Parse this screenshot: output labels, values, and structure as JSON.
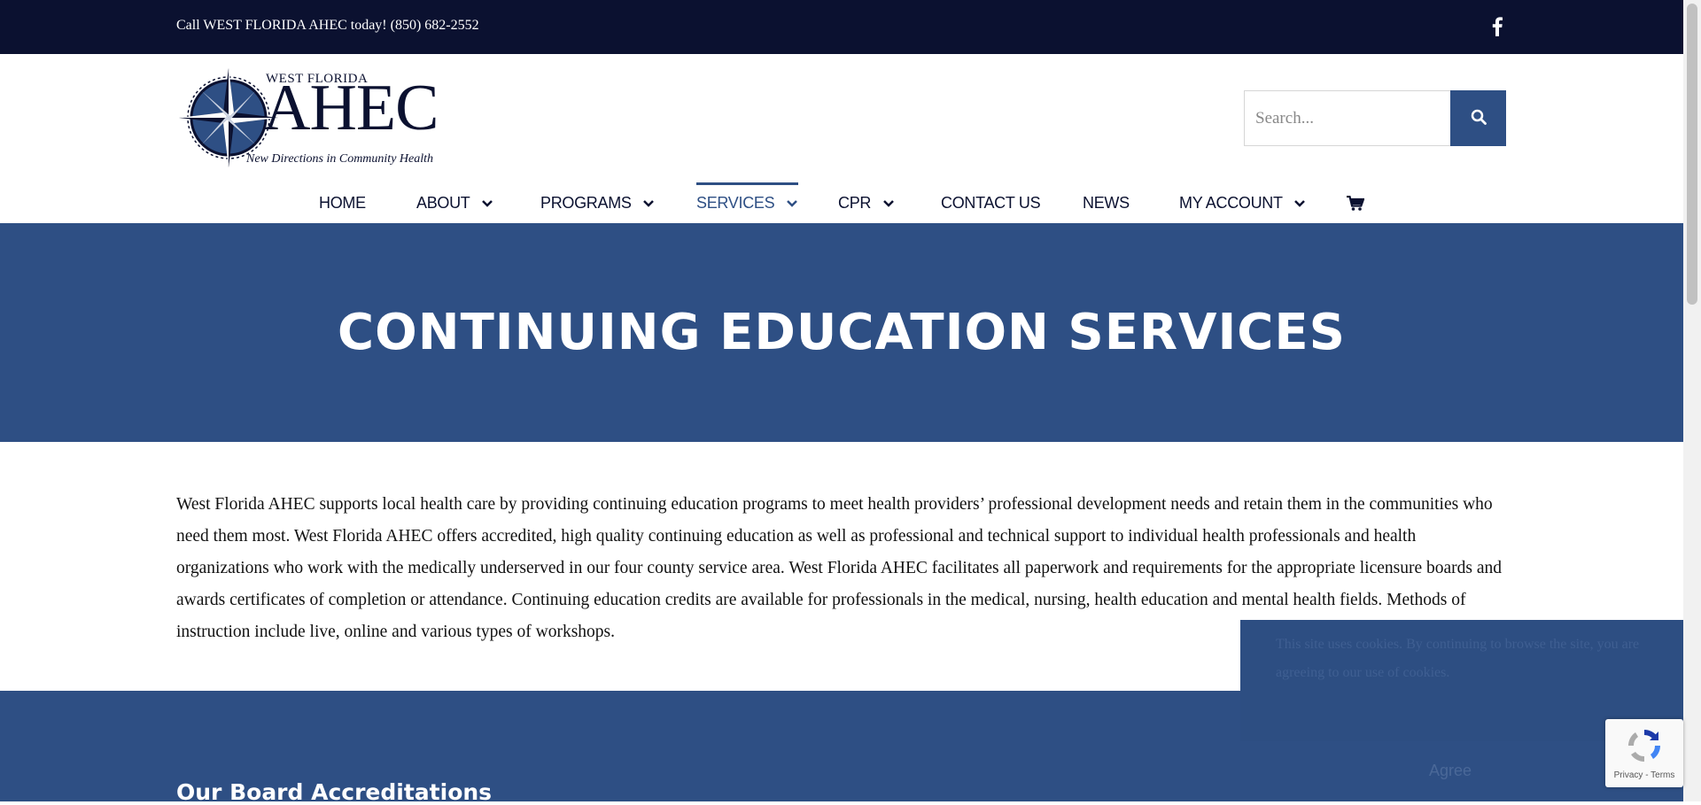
{
  "topbar": {
    "phone_text": "Call WEST FLORIDA AHEC today! (850) 682-2552",
    "social_icon": "facebook-icon"
  },
  "logo": {
    "line1": "WEST FLORIDA",
    "line2": "AHEC",
    "tagline": "New Directions in Community Health"
  },
  "search": {
    "placeholder": "Search...",
    "button_icon": "search-icon"
  },
  "nav": {
    "items": [
      {
        "label": "HOME",
        "has_dropdown": false
      },
      {
        "label": "ABOUT",
        "has_dropdown": true
      },
      {
        "label": "PROGRAMS",
        "has_dropdown": true
      },
      {
        "label": "SERVICES",
        "has_dropdown": true,
        "active": true
      },
      {
        "label": "CPR",
        "has_dropdown": true
      },
      {
        "label": "CONTACT US",
        "has_dropdown": false
      },
      {
        "label": "NEWS",
        "has_dropdown": false
      },
      {
        "label": "MY ACCOUNT",
        "has_dropdown": true
      }
    ],
    "cart_icon": "cart-icon"
  },
  "hero": {
    "title": "CONTINUING EDUCATION SERVICES"
  },
  "content": {
    "paragraph": "West Florida AHEC supports local health care by providing continuing education programs to meet health providers’ professional development needs and retain them in the communities who need them most. West Florida AHEC offers accredited, high quality continuing education as well as professional and technical support to individual health professionals and health organizations who work with the medically underserved in our four county service area. West Florida AHEC facilitates all paperwork and requirements for the appropriate licensure boards and awards certificates of completion or attendance. Continuing education credits are available for professionals in the medical, nursing, health education and mental health fields. Methods of instruction include live, online and various types of workshops."
  },
  "band": {
    "heading": "Our Board Accreditations"
  },
  "cookie": {
    "text": "This site uses cookies. By continuing to browse the site, you are agreeing to our use of cookies.",
    "agree_label": "Agree"
  },
  "recaptcha": {
    "links": "Privacy - Terms"
  },
  "colors": {
    "topbar": "#0b1130",
    "brand_blue": "#2e4f84",
    "nav_text": "#0b1130"
  }
}
